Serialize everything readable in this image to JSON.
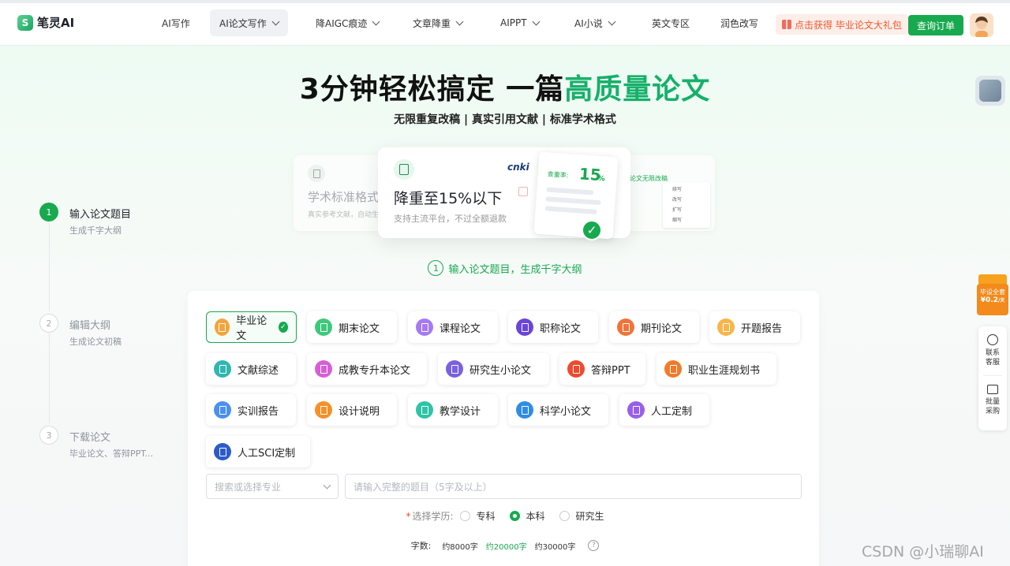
{
  "brand": {
    "name": "笔灵AI",
    "mark": "S"
  },
  "nav": {
    "items": [
      "AI写作",
      "AI论文写作",
      "降AIGC痕迹",
      "文章降重",
      "AIPPT",
      "AI小说",
      "英文专区",
      "润色改写"
    ],
    "promo": "点击获得 毕业论文大礼包",
    "order_btn": "查询订单"
  },
  "hero": {
    "title_a": "3分钟轻松搞定 一篇",
    "title_b": "高质量论文",
    "subtitle": "无限重复改稿 | 真实引用文献 | 标准学术格式"
  },
  "cards": {
    "left_title": "学术标准格式",
    "left_desc": "真实参考文献，自动生",
    "main_title": "降重至15%以下",
    "main_desc": "支持主流平台，不过全额退款",
    "cnki": "cnki",
    "rate_label": "查重率:",
    "rate_value": "15",
    "rate_unit": "%",
    "right_tag": "论文无限改稿",
    "right_items": [
      "续写",
      "改写",
      "扩写",
      "缩写"
    ]
  },
  "steps": [
    {
      "num": "1",
      "title": "输入论文题目",
      "desc": "生成千字大纲"
    },
    {
      "num": "2",
      "title": "编辑大纲",
      "desc": "生成论文初稿"
    },
    {
      "num": "3",
      "title": "下载论文",
      "desc": "毕业论文、答辩PPT..."
    }
  ],
  "step_hint": {
    "num": "1",
    "text": "输入论文题目，生成千字大纲"
  },
  "types": [
    "毕业论文",
    "期末论文",
    "课程论文",
    "职称论文",
    "期刊论文",
    "开题报告",
    "文献综述",
    "成教专升本论文",
    "研究生小论文",
    "答辩PPT",
    "职业生涯规划书",
    "实训报告",
    "设计说明",
    "教学设计",
    "科学小论文",
    "人工定制",
    "人工SCI定制"
  ],
  "major": {
    "placeholder": "搜索或选择专业"
  },
  "topic": {
    "placeholder": "请输入完整的题目（5字及以上）"
  },
  "degree": {
    "label": "选择学历:",
    "required": "*",
    "options": [
      "专科",
      "本科",
      "研究生"
    ],
    "selected": "本科"
  },
  "words": {
    "label": "字数:",
    "options": [
      "约8000字",
      "约20000字",
      "约30000字"
    ],
    "selected": "约20000字",
    "help": "?"
  },
  "side": {
    "gift_line1": "毕设全套",
    "gift_price": "¥0.2",
    "gift_unit": "/天",
    "service": "联系客服",
    "bulk": "批量采购"
  },
  "watermark": "CSDN @小瑞聊AI",
  "colors": {
    "brand_green": "#18a94f",
    "promo": "#f0582b"
  }
}
